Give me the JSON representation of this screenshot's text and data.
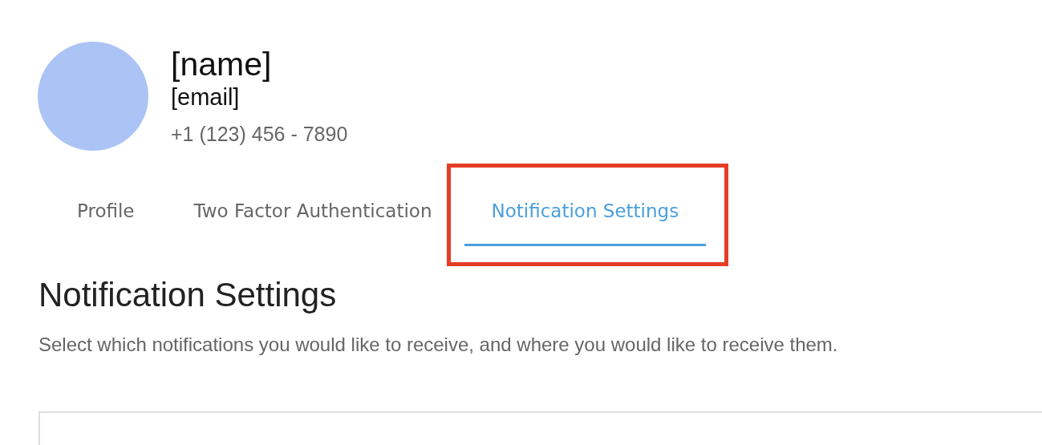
{
  "profile": {
    "name": "[name]",
    "email": "[email]",
    "phone": "+1 (123) 456 - 7890"
  },
  "tabs": [
    {
      "label": "Profile",
      "selected": false,
      "highlighted": false
    },
    {
      "label": "Two Factor Authentication",
      "selected": false,
      "highlighted": false
    },
    {
      "label": "Notification Settings",
      "selected": true,
      "highlighted": true
    }
  ],
  "section": {
    "title": "Notification Settings",
    "description": "Select which notifications you would like to receive, and where you would like to receive them."
  }
}
